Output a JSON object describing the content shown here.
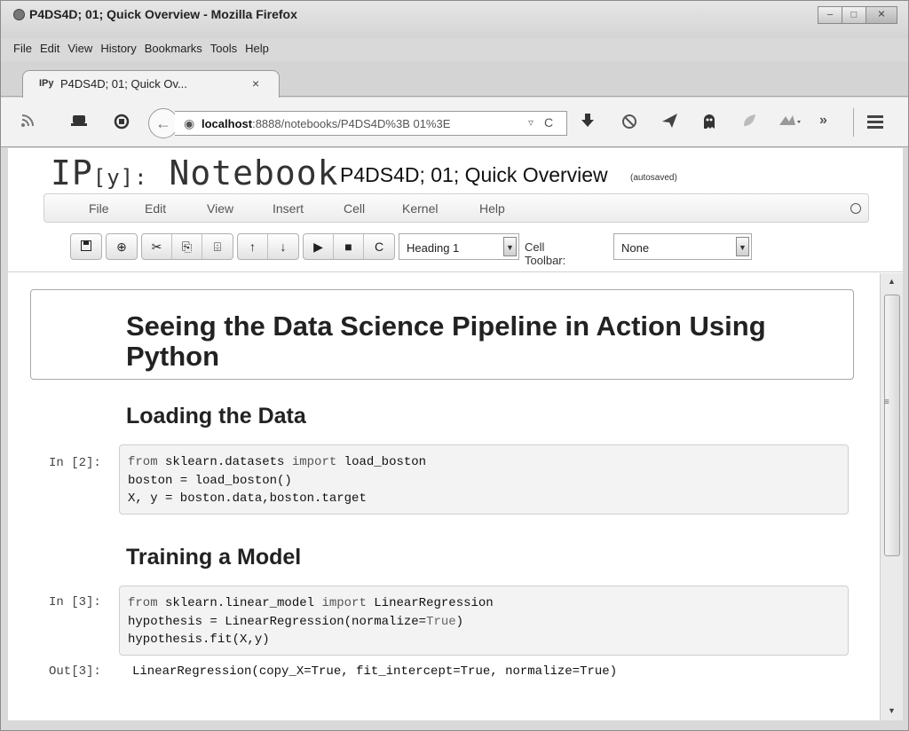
{
  "window": {
    "title": "P4DS4D; 01; Quick Overview - Mozilla Firefox",
    "minimize": "‒",
    "maximize": "□",
    "close": "✕"
  },
  "menu": [
    "File",
    "Edit",
    "View",
    "History",
    "Bookmarks",
    "Tools",
    "Help"
  ],
  "tab": {
    "icon_text": "IPy",
    "title": "P4DS4D; 01; Quick Ov...",
    "close": "×"
  },
  "navbar": {
    "url_host": "localhost",
    "url_path": ":8888/notebooks/P4DS4D%3B 01%3E",
    "dropdown": "▿",
    "reload": "C",
    "overflow": "»",
    "icons": [
      "rss-icon",
      "pocket-icon",
      "sync-icon",
      "download-icon",
      "block-icon",
      "send-icon",
      "ghost-icon",
      "leaf-icon",
      "puzzle-icon",
      "overflow-icon",
      "menu-icon"
    ]
  },
  "notebook": {
    "logo_main": "IP",
    "logo_bracket": "[y]:",
    "logo_word": "Notebook",
    "title": "P4DS4D; 01; Quick Overview",
    "autosaved": "(autosaved)",
    "menu": [
      "File",
      "Edit",
      "View",
      "Insert",
      "Cell",
      "Kernel",
      "Help"
    ],
    "toolbar": {
      "save": "💾",
      "insert": "⊕",
      "cut": "✂",
      "copy": "⎘",
      "paste": "⌹",
      "up": "↑",
      "down": "↓",
      "run": "▶",
      "stop": "■",
      "restart": "C",
      "cell_type": "Heading 1",
      "cell_toolbar_label": "Cell Toolbar:",
      "cell_toolbar_value": "None",
      "dropdown_arrow": "▼"
    }
  },
  "cells": {
    "heading1": "Seeing the Data Science Pipeline in Action Using Python",
    "heading2a": "Loading the Data",
    "prompt2": "In [2]:",
    "code2": {
      "l1a": "from",
      "l1b": " sklearn.datasets ",
      "l1c": "import",
      "l1d": " load_boston",
      "l2": "boston = load_boston()",
      "l3": "X, y = boston.data,boston.target"
    },
    "heading2b": "Training a Model",
    "prompt3": "In [3]:",
    "code3": {
      "l1a": "from",
      "l1b": " sklearn.linear_model ",
      "l1c": "import",
      "l1d": " LinearRegression",
      "l2a": "hypothesis = LinearRegression(normalize=",
      "l2b": "True",
      "l2c": ")",
      "l3": "hypothesis.fit(X,y)"
    },
    "out_prompt": "Out[3]:",
    "output": "LinearRegression(copy_X=True, fit_intercept=True, normalize=True)"
  },
  "scrollbar": {
    "up": "▲",
    "down": "▼",
    "grip": "≡"
  }
}
